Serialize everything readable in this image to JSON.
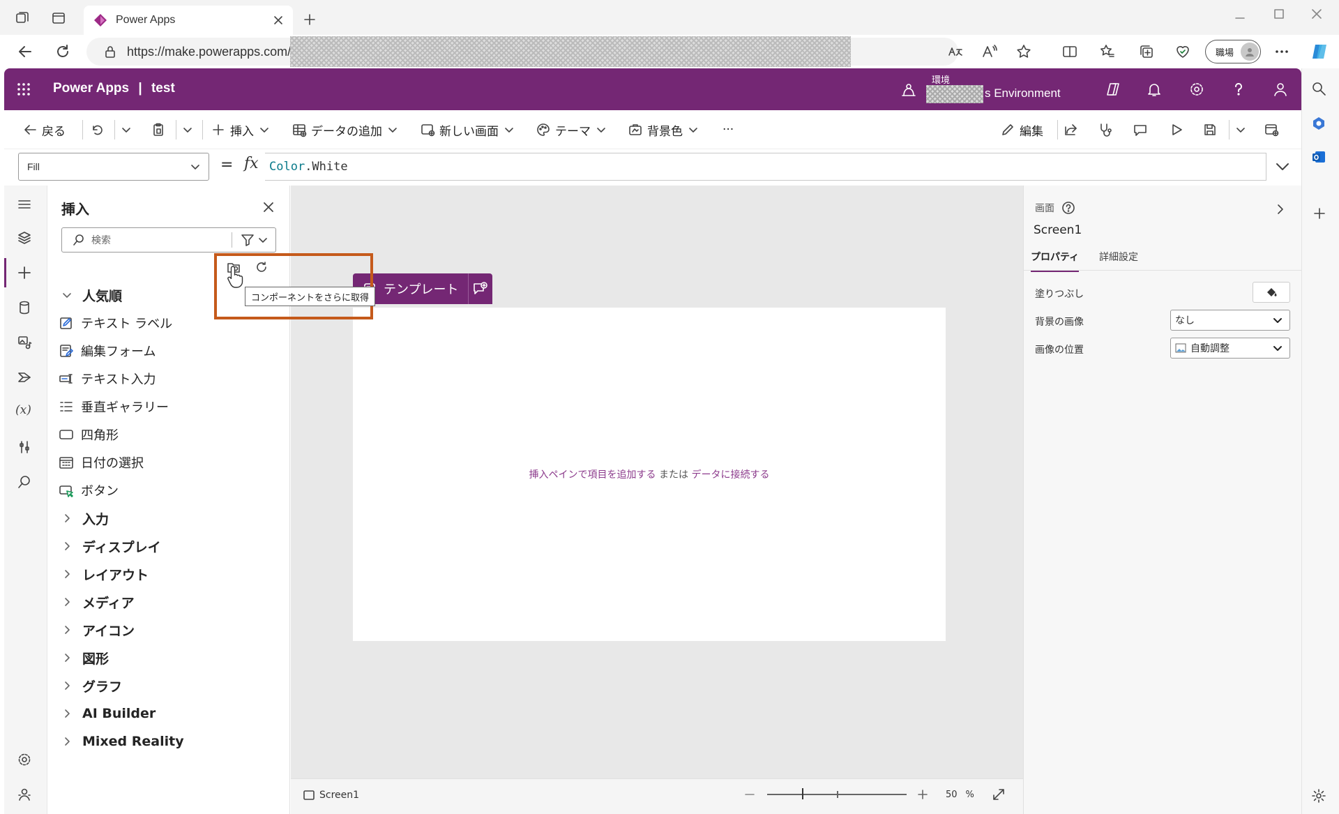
{
  "browser": {
    "tab_title": "Power Apps",
    "url": "https://make.powerapps.com/",
    "profile_label": "職場"
  },
  "header": {
    "app_name": "Power Apps",
    "separator": "|",
    "app_title": "test",
    "env_label": "環境",
    "env_name": "s Environment"
  },
  "toolbar": {
    "back": "戻る",
    "insert": "挿入",
    "add_data": "データの追加",
    "new_screen": "新しい画面",
    "theme": "テーマ",
    "background": "背景色",
    "more": "···",
    "edit": "編集"
  },
  "formula": {
    "property": "Fill",
    "equals": "=",
    "fx": "fx",
    "object": "Color",
    "member": ".White"
  },
  "insert_pane": {
    "title": "挿入",
    "search_placeholder": "検索",
    "tooltip": "コンポーネントをさらに取得",
    "popular_header": "人気順",
    "popular_items": [
      "テキスト ラベル",
      "編集フォーム",
      "テキスト入力",
      "垂直ギャラリー",
      "四角形",
      "日付の選択",
      "ボタン"
    ],
    "categories": [
      "入力",
      "ディスプレイ",
      "レイアウト",
      "メディア",
      "アイコン",
      "図形",
      "グラフ",
      "AI Builder",
      "Mixed Reality"
    ]
  },
  "canvas": {
    "template_label": "テンプレート",
    "hint_link1": "挿入ペインで項目を追加する",
    "hint_or": " または ",
    "hint_link2": "データに接続する",
    "screen_name": "Screen1",
    "zoom_value": "50",
    "zoom_unit": "%"
  },
  "properties": {
    "section_label": "画面",
    "screen_name": "Screen1",
    "tab_properties": "プロパティ",
    "tab_advanced": "詳細設定",
    "fill_label": "塗りつぶし",
    "bg_image_label": "背景の画像",
    "bg_image_value": "なし",
    "image_position_label": "画像の位置",
    "image_position_value": "自動調整"
  },
  "colors": {
    "brand": "#742774",
    "highlight": "#c55a1b"
  }
}
